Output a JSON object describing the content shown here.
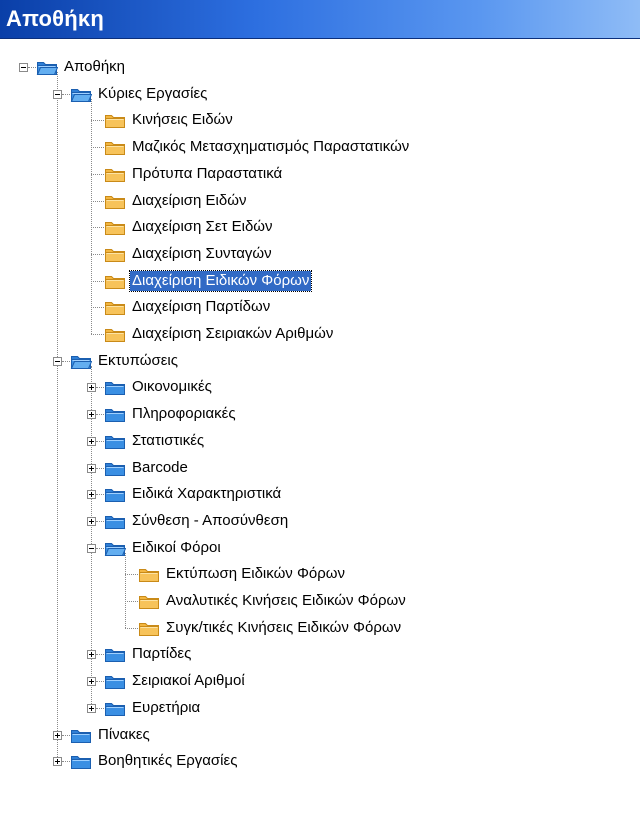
{
  "window": {
    "title": "Αποθήκη"
  },
  "colors": {
    "title_bar": "#2d6fe0",
    "selection": "#316ac5",
    "folder_blue": "#3a8fe3",
    "folder_yellow": "#f7c35a"
  },
  "tree": {
    "items": [
      {
        "label": "Αποθήκη",
        "level": 0,
        "expander": "minus",
        "icon": "folder-blue-open-icon"
      },
      {
        "label": "Κύριες Εργασίες",
        "level": 1,
        "expander": "minus",
        "icon": "folder-blue-open-icon"
      },
      {
        "label": "Κινήσεις Ειδών",
        "level": 2,
        "expander": "none",
        "icon": "folder-yellow-icon"
      },
      {
        "label": "Μαζικός Μετασχηματισμός Παραστατικών",
        "level": 2,
        "expander": "none",
        "icon": "folder-yellow-icon"
      },
      {
        "label": "Πρότυπα Παραστατικά",
        "level": 2,
        "expander": "none",
        "icon": "folder-yellow-icon"
      },
      {
        "label": "Διαχείριση Ειδών",
        "level": 2,
        "expander": "none",
        "icon": "folder-yellow-icon"
      },
      {
        "label": "Διαχείριση Σετ Ειδών",
        "level": 2,
        "expander": "none",
        "icon": "folder-yellow-icon"
      },
      {
        "label": "Διαχείριση Συνταγών",
        "level": 2,
        "expander": "none",
        "icon": "folder-yellow-icon"
      },
      {
        "label": "Διαχείριση Ειδικών Φόρων",
        "level": 2,
        "expander": "none",
        "icon": "folder-yellow-icon",
        "selected": true
      },
      {
        "label": "Διαχείριση Παρτίδων",
        "level": 2,
        "expander": "none",
        "icon": "folder-yellow-icon"
      },
      {
        "label": "Διαχείριση Σειριακών Αριθμών",
        "level": 2,
        "expander": "none",
        "icon": "folder-yellow-icon"
      },
      {
        "label": "Εκτυπώσεις",
        "level": 1,
        "expander": "minus",
        "icon": "folder-blue-open-icon"
      },
      {
        "label": "Οικονομικές",
        "level": 2,
        "expander": "plus",
        "icon": "folder-blue-icon"
      },
      {
        "label": "Πληροφοριακές",
        "level": 2,
        "expander": "plus",
        "icon": "folder-blue-icon"
      },
      {
        "label": "Στατιστικές",
        "level": 2,
        "expander": "plus",
        "icon": "folder-blue-icon"
      },
      {
        "label": "Barcode",
        "level": 2,
        "expander": "plus",
        "icon": "folder-blue-icon"
      },
      {
        "label": "Ειδικά Χαρακτηριστικά",
        "level": 2,
        "expander": "plus",
        "icon": "folder-blue-icon"
      },
      {
        "label": "Σύνθεση - Αποσύνθεση",
        "level": 2,
        "expander": "plus",
        "icon": "folder-blue-icon"
      },
      {
        "label": "Ειδικοί Φόροι",
        "level": 2,
        "expander": "minus",
        "icon": "folder-blue-open-icon"
      },
      {
        "label": "Εκτύπωση Ειδικών Φόρων",
        "level": 3,
        "expander": "none",
        "icon": "folder-yellow-icon"
      },
      {
        "label": "Αναλυτικές Κινήσεις Ειδικών Φόρων",
        "level": 3,
        "expander": "none",
        "icon": "folder-yellow-icon"
      },
      {
        "label": "Συγκ/τικές Κινήσεις Ειδικών Φόρων",
        "level": 3,
        "expander": "none",
        "icon": "folder-yellow-icon"
      },
      {
        "label": "Παρτίδες",
        "level": 2,
        "expander": "plus",
        "icon": "folder-blue-icon"
      },
      {
        "label": "Σειριακοί Αριθμοί",
        "level": 2,
        "expander": "plus",
        "icon": "folder-blue-icon"
      },
      {
        "label": "Ευρετήρια",
        "level": 2,
        "expander": "plus",
        "icon": "folder-blue-icon"
      },
      {
        "label": "Πίνακες",
        "level": 1,
        "expander": "plus",
        "icon": "folder-blue-icon"
      },
      {
        "label": "Βοηθητικές Εργασίες",
        "level": 1,
        "expander": "plus",
        "icon": "folder-blue-icon"
      }
    ]
  }
}
